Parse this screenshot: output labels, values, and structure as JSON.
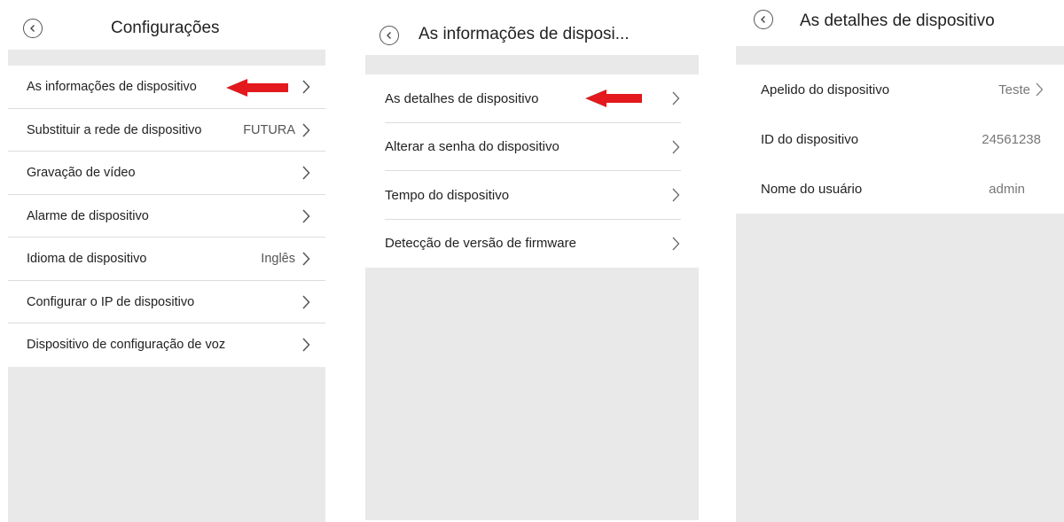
{
  "screens": [
    {
      "title": "Configurações",
      "items": [
        {
          "label": "As informações de dispositivo",
          "value": ""
        },
        {
          "label": "Substituir a rede de dispositivo",
          "value": "FUTURA"
        },
        {
          "label": "Gravação de vídeo",
          "value": ""
        },
        {
          "label": "Alarme de dispositivo",
          "value": ""
        },
        {
          "label": "Idioma de dispositivo",
          "value": "Inglês"
        },
        {
          "label": "Configurar o IP de dispositivo",
          "value": ""
        },
        {
          "label": "Dispositivo de configuração de voz",
          "value": ""
        }
      ]
    },
    {
      "title": "As informações de disposi...",
      "items": [
        {
          "label": "As detalhes de dispositivo"
        },
        {
          "label": "Alterar a senha do dispositivo"
        },
        {
          "label": "Tempo do dispositivo"
        },
        {
          "label": "Detecção de versão de firmware"
        }
      ]
    },
    {
      "title": "As detalhes de dispositivo",
      "items": [
        {
          "label": "Apelido do dispositivo",
          "value": "Teste"
        },
        {
          "label": "ID do dispositivo",
          "value": "24561238"
        },
        {
          "label": "Nome do usuário",
          "value": "admin"
        }
      ]
    }
  ],
  "colors": {
    "highlight_arrow": "#e3191e",
    "background_gray": "#e9e9e9"
  },
  "icons": {
    "back": "chevron-left-circle-icon",
    "row_arrow": "chevron-right-icon"
  }
}
